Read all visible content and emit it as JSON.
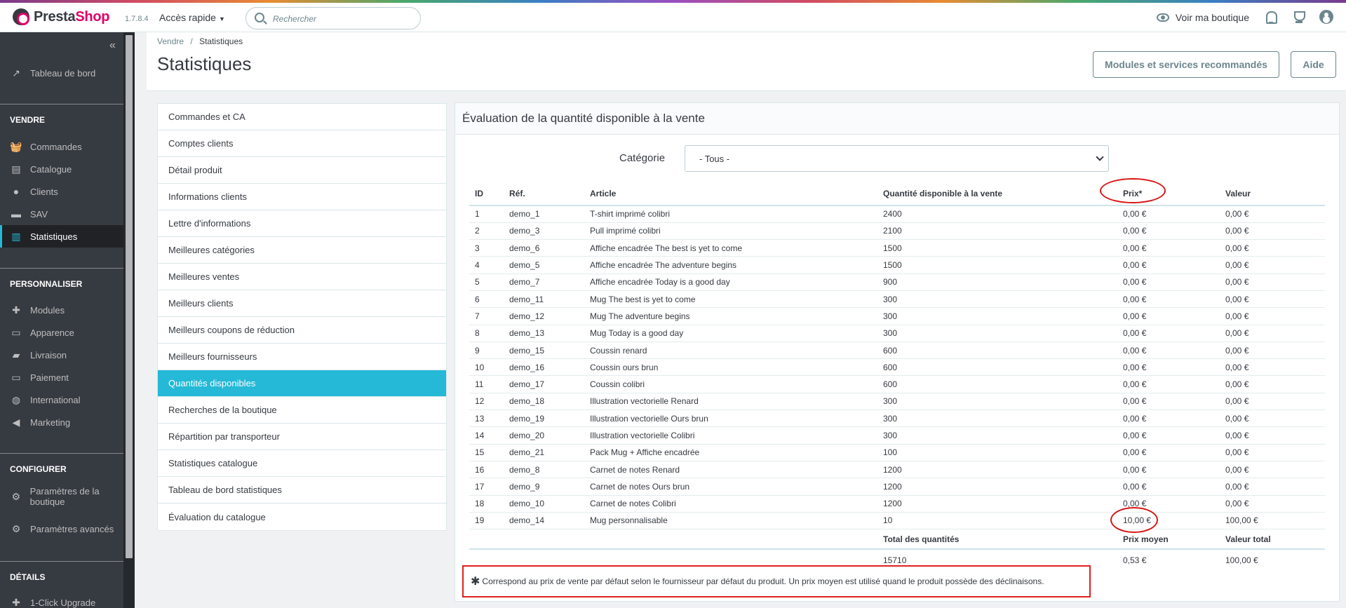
{
  "header": {
    "logo_text_a": "Presta",
    "logo_text_b": "Shop",
    "version": "1.7.8.4",
    "quick_access": "Accès rapide",
    "search_placeholder": "Rechercher",
    "view_shop": "Voir ma boutique",
    "icons": [
      "eye-icon",
      "bell-icon",
      "trophy-icon",
      "user-icon"
    ]
  },
  "sidebar": {
    "collapse": "«",
    "dashboard": "Tableau de bord",
    "sections": [
      {
        "title": "VENDRE",
        "items": [
          "Commandes",
          "Catalogue",
          "Clients",
          "SAV",
          "Statistiques"
        ]
      },
      {
        "title": "PERSONNALISER",
        "items": [
          "Modules",
          "Apparence",
          "Livraison",
          "Paiement",
          "International",
          "Marketing"
        ]
      },
      {
        "title": "CONFIGURER",
        "items": [
          "Paramètres de la boutique",
          "Paramètres avancés"
        ]
      },
      {
        "title": "DÉTAILS",
        "items": [
          "1-Click Upgrade"
        ]
      }
    ],
    "active_item": "Statistiques"
  },
  "page": {
    "breadcrumb_parent": "Vendre",
    "breadcrumb_separator": "/",
    "breadcrumb_current": "Statistiques",
    "title": "Statistiques",
    "btn_modules": "Modules et services recommandés",
    "btn_help": "Aide"
  },
  "stats_menu": {
    "items": [
      "Commandes et CA",
      "Comptes clients",
      "Détail produit",
      "Informations clients",
      "Lettre d'informations",
      "Meilleures catégories",
      "Meilleures ventes",
      "Meilleurs clients",
      "Meilleurs coupons de réduction",
      "Meilleurs fournisseurs",
      "Quantités disponibles",
      "Recherches de la boutique",
      "Répartition par transporteur",
      "Statistiques catalogue",
      "Tableau de bord statistiques",
      "Évaluation du catalogue"
    ],
    "active_index": 10
  },
  "panel": {
    "title": "Évaluation de la quantité disponible à la vente",
    "category_label": "Catégorie",
    "category_value": "- Tous -",
    "columns": [
      "ID",
      "Réf.",
      "Article",
      "Quantité disponible à la vente",
      "Prix*",
      "Valeur"
    ],
    "rows": [
      [
        "1",
        "demo_1",
        "T-shirt imprimé colibri",
        "2400",
        "0,00 €",
        "0,00 €"
      ],
      [
        "2",
        "demo_3",
        "Pull imprimé colibri",
        "2100",
        "0,00 €",
        "0,00 €"
      ],
      [
        "3",
        "demo_6",
        "Affiche encadrée The best is yet to come",
        "1500",
        "0,00 €",
        "0,00 €"
      ],
      [
        "4",
        "demo_5",
        "Affiche encadrée The adventure begins",
        "1500",
        "0,00 €",
        "0,00 €"
      ],
      [
        "5",
        "demo_7",
        "Affiche encadrée Today is a good day",
        "900",
        "0,00 €",
        "0,00 €"
      ],
      [
        "6",
        "demo_11",
        "Mug The best is yet to come",
        "300",
        "0,00 €",
        "0,00 €"
      ],
      [
        "7",
        "demo_12",
        "Mug The adventure begins",
        "300",
        "0,00 €",
        "0,00 €"
      ],
      [
        "8",
        "demo_13",
        "Mug Today is a good day",
        "300",
        "0,00 €",
        "0,00 €"
      ],
      [
        "9",
        "demo_15",
        "Coussin renard",
        "600",
        "0,00 €",
        "0,00 €"
      ],
      [
        "10",
        "demo_16",
        "Coussin ours brun",
        "600",
        "0,00 €",
        "0,00 €"
      ],
      [
        "11",
        "demo_17",
        "Coussin colibri",
        "600",
        "0,00 €",
        "0,00 €"
      ],
      [
        "12",
        "demo_18",
        "Illustration vectorielle Renard",
        "300",
        "0,00 €",
        "0,00 €"
      ],
      [
        "13",
        "demo_19",
        "Illustration vectorielle Ours brun",
        "300",
        "0,00 €",
        "0,00 €"
      ],
      [
        "14",
        "demo_20",
        "Illustration vectorielle Colibri",
        "300",
        "0,00 €",
        "0,00 €"
      ],
      [
        "15",
        "demo_21",
        "Pack Mug + Affiche encadrée",
        "100",
        "0,00 €",
        "0,00 €"
      ],
      [
        "16",
        "demo_8",
        "Carnet de notes Renard",
        "1200",
        "0,00 €",
        "0,00 €"
      ],
      [
        "17",
        "demo_9",
        "Carnet de notes Ours brun",
        "1200",
        "0,00 €",
        "0,00 €"
      ],
      [
        "18",
        "demo_10",
        "Carnet de notes Colibri",
        "1200",
        "0,00 €",
        "0,00 €"
      ],
      [
        "19",
        "demo_14",
        "Mug personnalisable",
        "10",
        "10,00 €",
        "100,00 €"
      ]
    ],
    "totals": {
      "qty_label": "Total des quantités",
      "qty_value": "15710",
      "avg_label": "Prix moyen",
      "avg_value": "0,53 €",
      "total_label": "Valeur total",
      "total_value": "100,00 €"
    },
    "footnote_star": "✱",
    "footnote": "Correspond au prix de vente par défaut selon le fournisseur par défaut du produit. Un prix moyen est utilisé quand le produit possède des déclinaisons."
  },
  "colors": {
    "accent": "#25b9d7",
    "brand": "#df0067",
    "sidebar_bg": "#363a41",
    "annotation_red": "#d81616"
  }
}
